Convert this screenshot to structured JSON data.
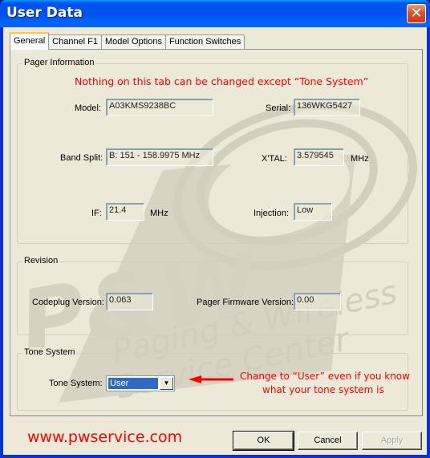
{
  "window": {
    "title": "User Data",
    "close_icon": "close-icon"
  },
  "tabs": [
    {
      "label": "General",
      "active": true
    },
    {
      "label": "Channel F1",
      "active": false
    },
    {
      "label": "Model Options",
      "active": false
    },
    {
      "label": "Function Switches",
      "active": false
    }
  ],
  "pager_info": {
    "group_label": "Pager Information",
    "notice": "Nothing on this tab can be changed except “Tone System”",
    "model_label": "Model:",
    "model_value": "A03KMS9238BC",
    "serial_label": "Serial:",
    "serial_value": "136WKG5427",
    "band_split_label": "Band Split:",
    "band_split_value": "B: 151 - 158.9975 MHz",
    "xtal_label": "X'TAL:",
    "xtal_value": "3.579545",
    "xtal_unit": "MHz",
    "if_label": "IF:",
    "if_value": "21.4",
    "if_unit": "MHz",
    "injection_label": "Injection:",
    "injection_value": "Low"
  },
  "revision": {
    "group_label": "Revision",
    "codeplug_label": "Codeplug Version:",
    "codeplug_value": "0.063",
    "firmware_label": "Pager Firmware Version:",
    "firmware_value": "0.00"
  },
  "tone_system": {
    "group_label": "Tone System",
    "label": "Tone System:",
    "selected": "User",
    "annotation_line1": "Change to “User” even if you know",
    "annotation_line2": "what your tone system is"
  },
  "watermark": {
    "logo": "P&W",
    "line1": "Paging & Wireless",
    "line2": "Service Center"
  },
  "footer": {
    "website": "www.pwservice.com",
    "ok_label": "OK",
    "cancel_label": "Cancel",
    "apply_label": "Apply"
  },
  "colors": {
    "annotation_red": "#ff0000",
    "selection_blue": "#316ac5",
    "titlebar_blue": "#0054e3"
  }
}
